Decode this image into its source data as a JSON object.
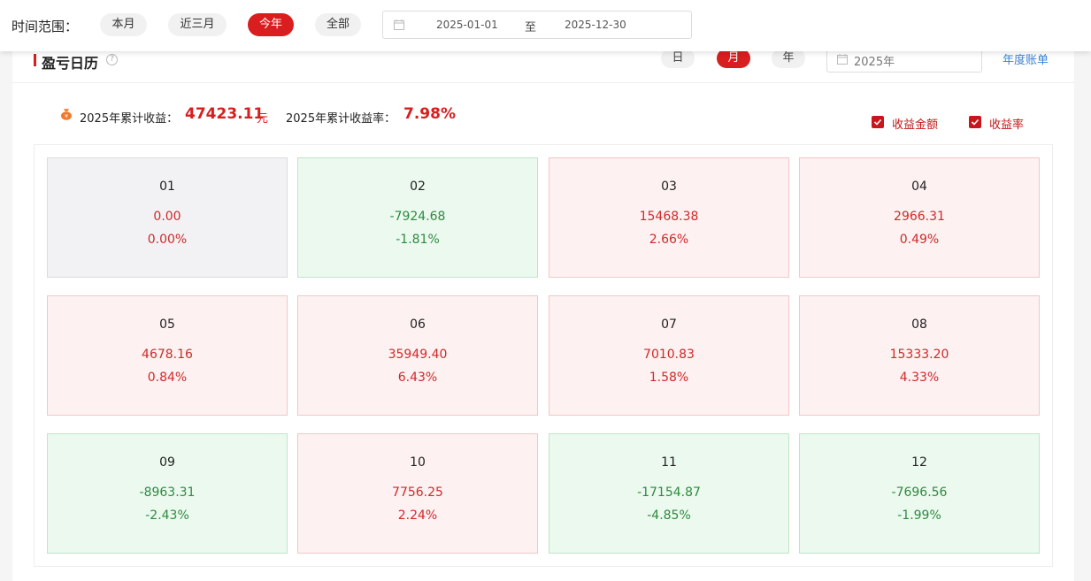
{
  "topbar": {
    "range_label": "时间范围：",
    "ranges": [
      {
        "label": "本月",
        "active": false
      },
      {
        "label": "近三月",
        "active": false
      },
      {
        "label": "今年",
        "active": true
      },
      {
        "label": "全部",
        "active": false
      }
    ],
    "date_start": "2025-01-01",
    "date_to": "至",
    "date_end": "2025-12-30"
  },
  "panel": {
    "title": "盈亏日历",
    "help": "?",
    "view_tabs": [
      {
        "label": "日",
        "active": false
      },
      {
        "label": "月",
        "active": true
      },
      {
        "label": "年",
        "active": false
      }
    ],
    "year_value": "2025年",
    "annual_link": "年度账单"
  },
  "summary": {
    "profit_label": "2025年累计收益：",
    "profit_value": "47423.11",
    "profit_unit": "元",
    "rate_label": "2025年累计收益率：",
    "rate_value": "7.98%"
  },
  "options": [
    {
      "label": "收益金额",
      "checked": true
    },
    {
      "label": "收益率",
      "checked": true
    }
  ],
  "months": [
    {
      "month": "01",
      "amount": "0.00",
      "rate": "0.00%",
      "status": "zero"
    },
    {
      "month": "02",
      "amount": "-7924.68",
      "rate": "-1.81%",
      "status": "neg"
    },
    {
      "month": "03",
      "amount": "15468.38",
      "rate": "2.66%",
      "status": "pos"
    },
    {
      "month": "04",
      "amount": "2966.31",
      "rate": "0.49%",
      "status": "pos"
    },
    {
      "month": "05",
      "amount": "4678.16",
      "rate": "0.84%",
      "status": "pos"
    },
    {
      "month": "06",
      "amount": "35949.40",
      "rate": "6.43%",
      "status": "pos"
    },
    {
      "month": "07",
      "amount": "7010.83",
      "rate": "1.58%",
      "status": "pos"
    },
    {
      "month": "08",
      "amount": "15333.20",
      "rate": "4.33%",
      "status": "pos"
    },
    {
      "month": "09",
      "amount": "-8963.31",
      "rate": "-2.43%",
      "status": "neg"
    },
    {
      "month": "10",
      "amount": "7756.25",
      "rate": "2.24%",
      "status": "pos"
    },
    {
      "month": "11",
      "amount": "-17154.87",
      "rate": "-4.85%",
      "status": "neg"
    },
    {
      "month": "12",
      "amount": "-7696.56",
      "rate": "-1.99%",
      "status": "neg"
    }
  ],
  "colors": {
    "accent": "#d81e1e",
    "positive": "#d02a2a",
    "negative": "#2e8b3e",
    "link": "#3b82d6"
  }
}
